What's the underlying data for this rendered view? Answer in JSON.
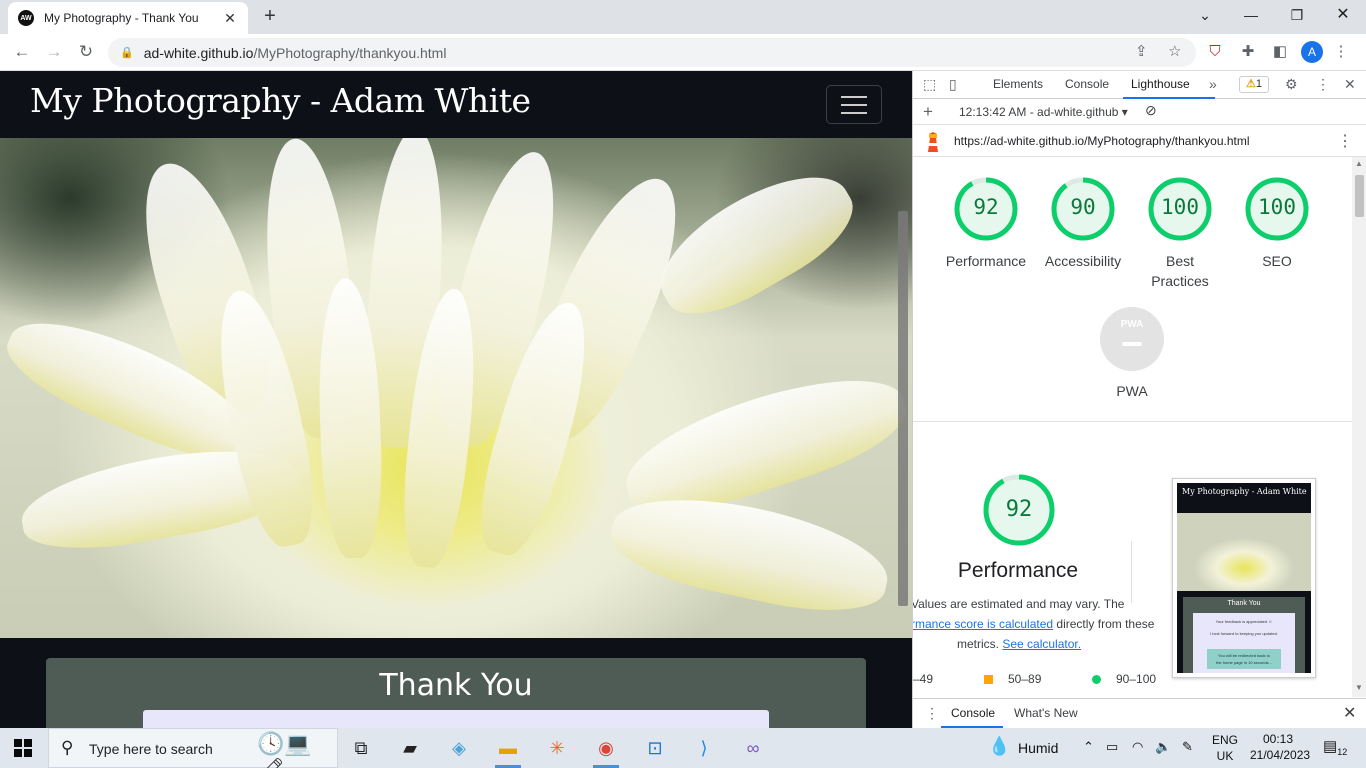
{
  "browser": {
    "tab_title": "My Photography - Thank You",
    "favicon_text": "AW",
    "url_host": "ad-white.github.io",
    "url_path": "/MyPhotography/thankyou.html",
    "profile_initial": "A"
  },
  "page": {
    "brand": "My Photography - Adam White",
    "card_title": "Thank You"
  },
  "devtools": {
    "tabs": [
      "Elements",
      "Console",
      "Lighthouse"
    ],
    "active_tab": "Lighthouse",
    "warning_count": "1",
    "report_time": "12:13:42 AM - ad-white.github",
    "report_url": "https://ad-white.github.io/MyPhotography/thankyou.html",
    "scores": [
      {
        "label": "Performance",
        "value": 92
      },
      {
        "label": "Accessibility",
        "value": 90
      },
      {
        "label": "Best",
        "label2": "Practices",
        "value": 100
      },
      {
        "label": "SEO",
        "value": 100
      }
    ],
    "pwa_label": "PWA",
    "pwa_badge": "PWA",
    "perf_score": 92,
    "perf_title": "Performance",
    "perf_desc_1": "Values are estimated and may vary. The",
    "perf_desc_link1": "rmance score is calculated",
    "perf_desc_2": " directly from these",
    "perf_desc_3": "metrics.",
    "perf_desc_link2": "See calculator.",
    "legend": [
      "–49",
      "50–89",
      "90–100"
    ],
    "thumb": {
      "brand": "My Photography - Adam White",
      "title": "Thank You",
      "line1": "Your feedback is appreciated ☺",
      "line2": "I look forward to keeping you updated.",
      "box1": "You will be redirected back to",
      "box2": "the home page in 10 seconds..."
    },
    "drawer_tabs": [
      "Console",
      "What's New"
    ]
  },
  "taskbar": {
    "search_placeholder": "Type here to search",
    "weather": "Humid",
    "lang1": "ENG",
    "lang2": "UK",
    "time": "00:13",
    "date": "21/04/2023",
    "notifications": "12"
  },
  "colors": {
    "score_green": "#0cce6b",
    "score_orange": "#ffa400",
    "accent_blue": "#1a73e8",
    "site_bg": "#0d1117",
    "card_bg": "#4f5b55"
  }
}
